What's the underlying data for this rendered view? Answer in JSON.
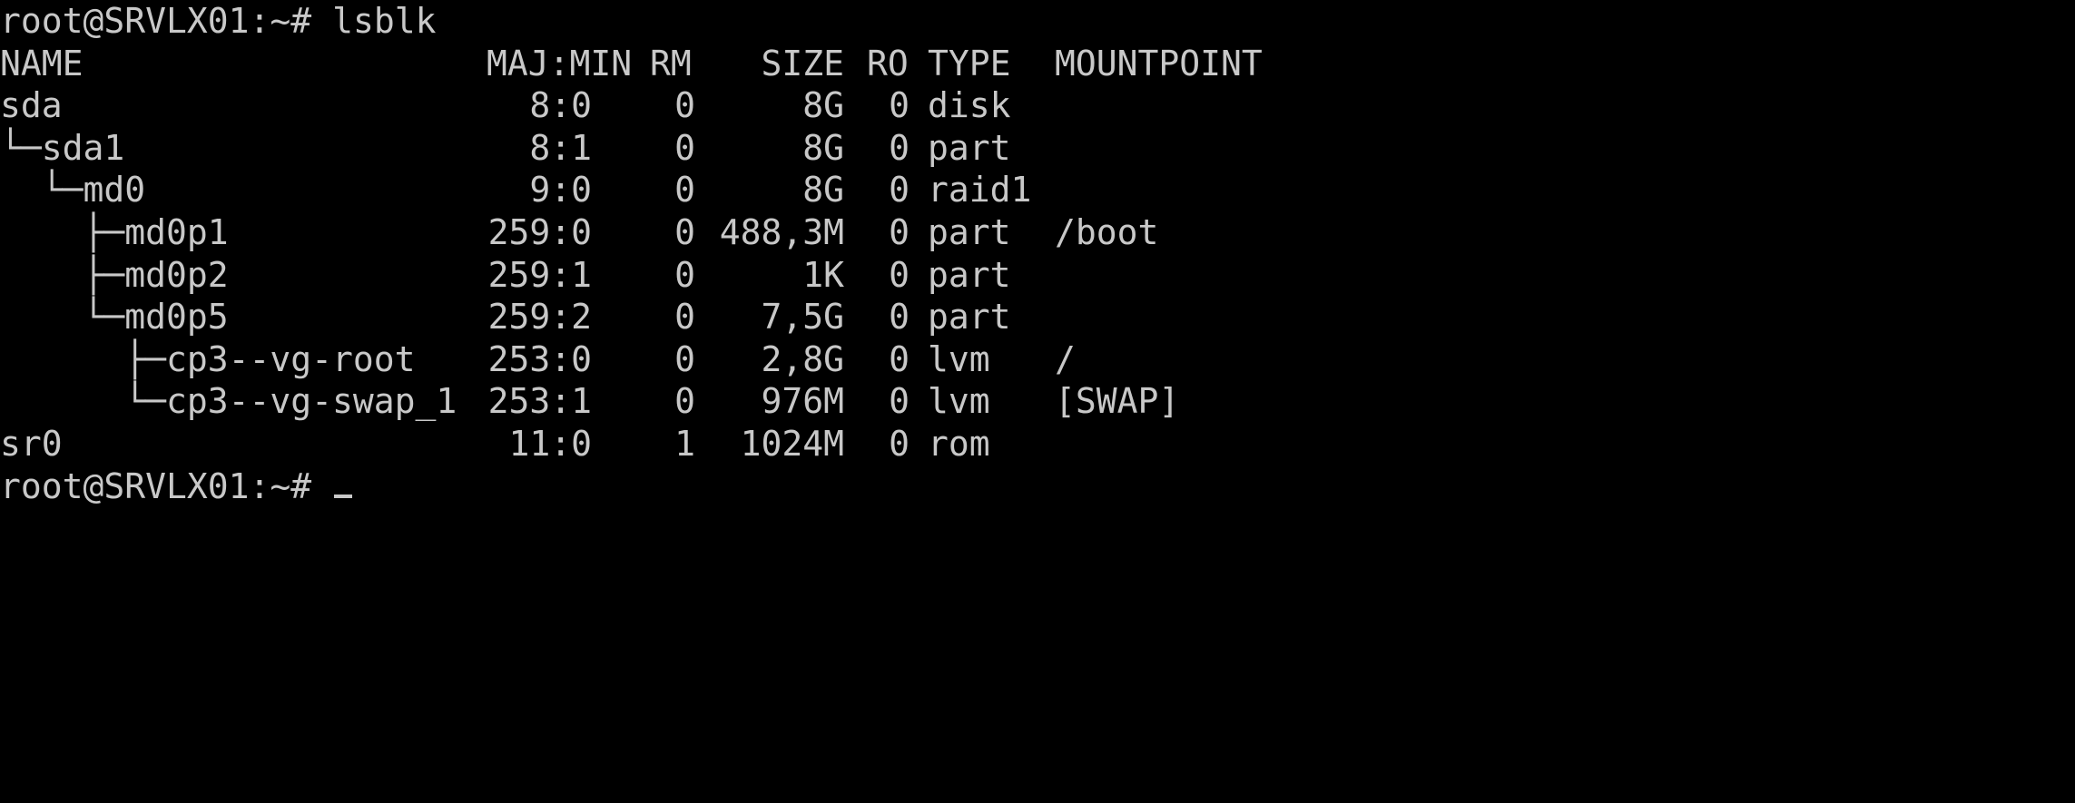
{
  "terminal": {
    "prompt": "root@SRVLX01:~#",
    "command": "lsblk",
    "headers": {
      "name": "NAME",
      "majmin": "MAJ:MIN",
      "rm": "RM",
      "size": "SIZE",
      "ro": "RO",
      "type": "TYPE",
      "mountpoint": "MOUNTPOINT"
    },
    "rows": [
      {
        "name": "sda",
        "majmin": "8:0",
        "rm": "0",
        "size": "8G",
        "ro": "0",
        "type": "disk",
        "mountpoint": ""
      },
      {
        "name": "└─sda1",
        "majmin": "8:1",
        "rm": "0",
        "size": "8G",
        "ro": "0",
        "type": "part",
        "mountpoint": ""
      },
      {
        "name": "  └─md0",
        "majmin": "9:0",
        "rm": "0",
        "size": "8G",
        "ro": "0",
        "type": "raid1",
        "mountpoint": ""
      },
      {
        "name": "    ├─md0p1",
        "majmin": "259:0",
        "rm": "0",
        "size": "488,3M",
        "ro": "0",
        "type": "part",
        "mountpoint": "/boot"
      },
      {
        "name": "    ├─md0p2",
        "majmin": "259:1",
        "rm": "0",
        "size": "1K",
        "ro": "0",
        "type": "part",
        "mountpoint": ""
      },
      {
        "name": "    └─md0p5",
        "majmin": "259:2",
        "rm": "0",
        "size": "7,5G",
        "ro": "0",
        "type": "part",
        "mountpoint": ""
      },
      {
        "name": "      ├─cp3--vg-root",
        "majmin": "253:0",
        "rm": "0",
        "size": "2,8G",
        "ro": "0",
        "type": "lvm",
        "mountpoint": "/"
      },
      {
        "name": "      └─cp3--vg-swap_1",
        "majmin": "253:1",
        "rm": "0",
        "size": "976M",
        "ro": "0",
        "type": "lvm",
        "mountpoint": "[SWAP]"
      },
      {
        "name": "sr0",
        "majmin": "11:0",
        "rm": "1",
        "size": "1024M",
        "ro": "0",
        "type": "rom",
        "mountpoint": ""
      }
    ],
    "final_prompt": "root@SRVLX01:~#",
    "colors": {
      "background": "#000000",
      "foreground": "#c8c8c8"
    }
  }
}
